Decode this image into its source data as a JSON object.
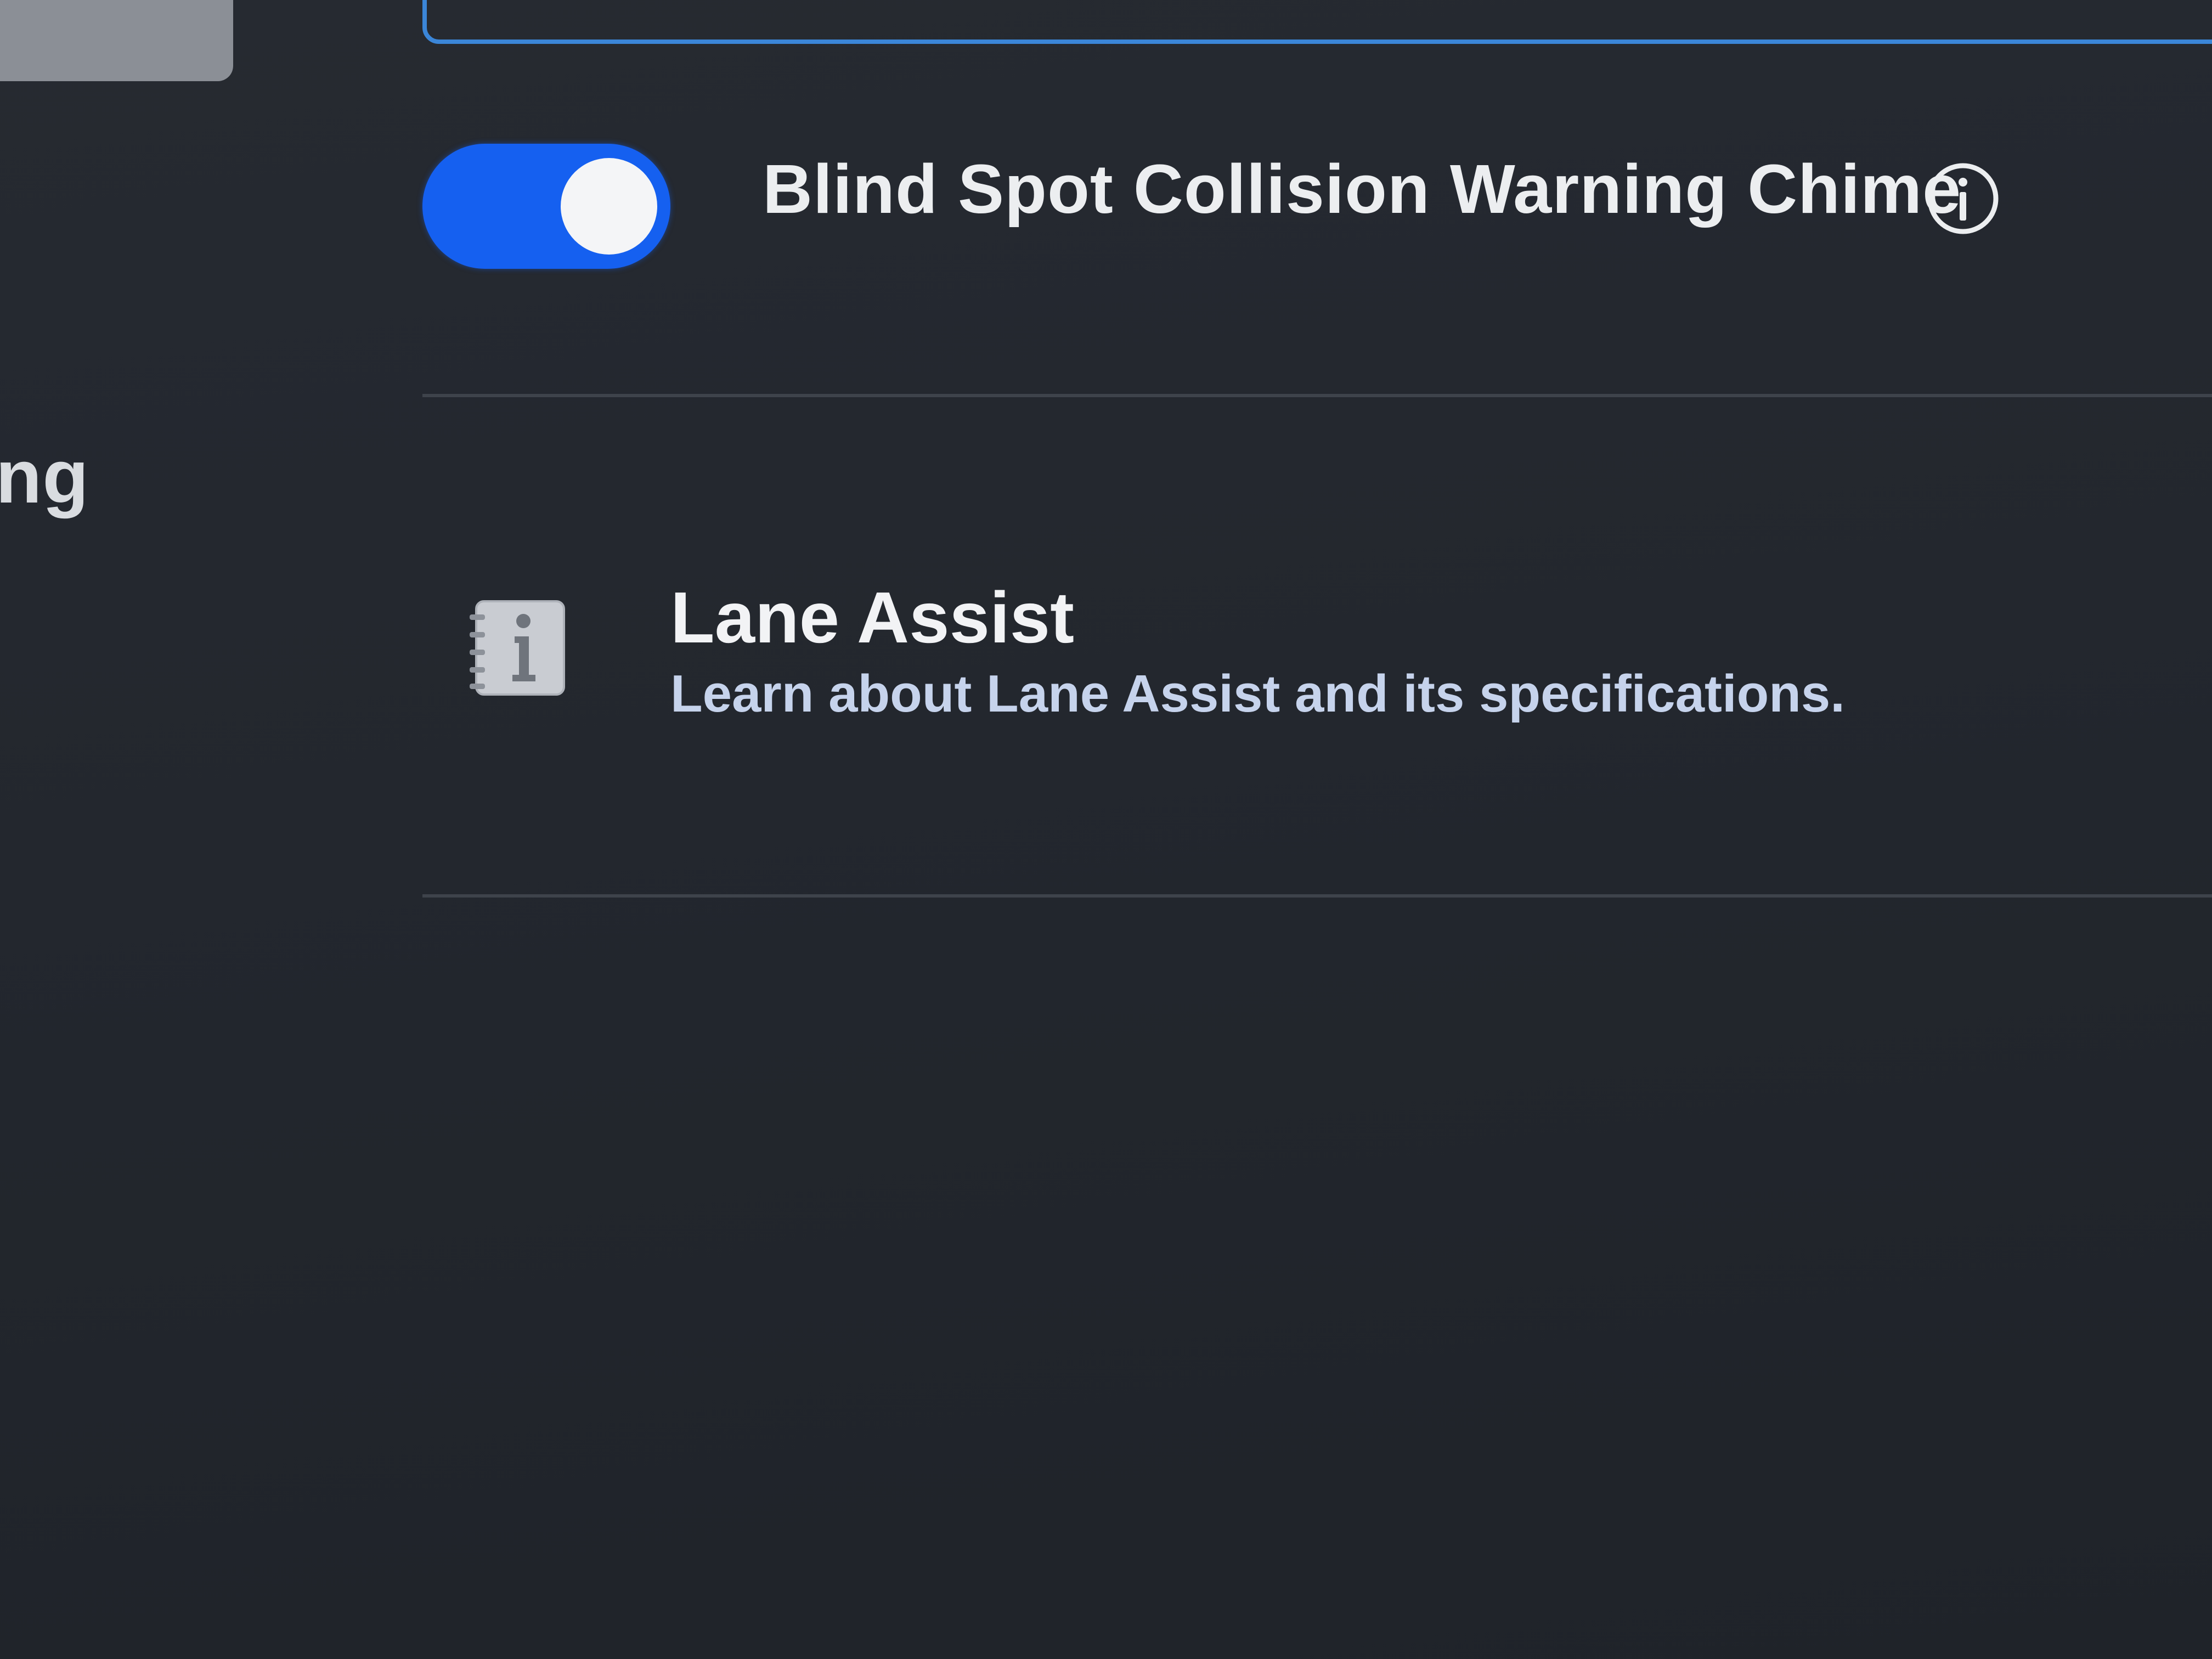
{
  "sidebar": {
    "selected_item": "",
    "partial_item_label": "ng"
  },
  "settings": {
    "blind_spot_chime": {
      "label": "Blind Spot Collision Warning Chime",
      "enabled": true,
      "info_icon": "info-circle-icon"
    },
    "lane_assist_manual": {
      "icon": "manual-info-icon",
      "title": "Lane Assist",
      "subtitle": "Learn about Lane Assist and its specifications."
    }
  },
  "colors": {
    "background": "#23272e",
    "toggle_on": "#1560f0",
    "panel_border": "#3b86d8",
    "subtitle_text": "#c6d3ec"
  }
}
